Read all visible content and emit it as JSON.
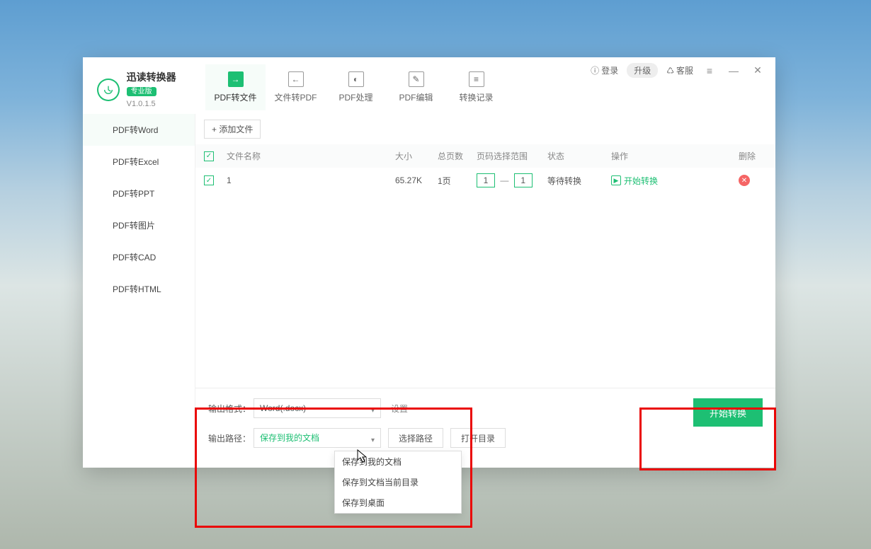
{
  "brand": {
    "name": "迅读转换器",
    "badge": "专业版",
    "version": "V1.0.1.5"
  },
  "titlebar": {
    "login": "登录",
    "upgrade": "升级",
    "support": "客服",
    "menu_icon": "menu",
    "min_icon": "minimize",
    "close_icon": "close"
  },
  "tabs": [
    {
      "label": "PDF转文件",
      "icon": "→"
    },
    {
      "label": "文件转PDF",
      "icon": "←"
    },
    {
      "label": "PDF处理",
      "icon": "◐"
    },
    {
      "label": "PDF编辑",
      "icon": "✎"
    },
    {
      "label": "转换记录",
      "icon": "≡"
    }
  ],
  "sidebar": {
    "items": [
      {
        "label": "PDF转Word"
      },
      {
        "label": "PDF转Excel"
      },
      {
        "label": "PDF转PPT"
      },
      {
        "label": "PDF转图片"
      },
      {
        "label": "PDF转CAD"
      },
      {
        "label": "PDF转HTML"
      }
    ]
  },
  "toolbar": {
    "add_file": "+ 添加文件"
  },
  "columns": {
    "name": "文件名称",
    "size": "大小",
    "pages": "总页数",
    "range": "页码选择范围",
    "status": "状态",
    "action": "操作",
    "delete": "删除"
  },
  "rows": [
    {
      "name": "1",
      "size": "65.27K",
      "pages": "1页",
      "range_from": "1",
      "range_to": "1",
      "status": "等待转换",
      "action": "开始转换"
    }
  ],
  "footer": {
    "format_label": "输出格式：",
    "format_value": "Word(.docx)",
    "settings": "设置",
    "path_label": "输出路径：",
    "path_value": "保存到我的文档",
    "choose_path": "选择路径",
    "open_dir": "打开目录",
    "convert": "开始转换",
    "path_options": [
      "保存到我的文档",
      "保存到文档当前目录",
      "保存到桌面"
    ]
  }
}
